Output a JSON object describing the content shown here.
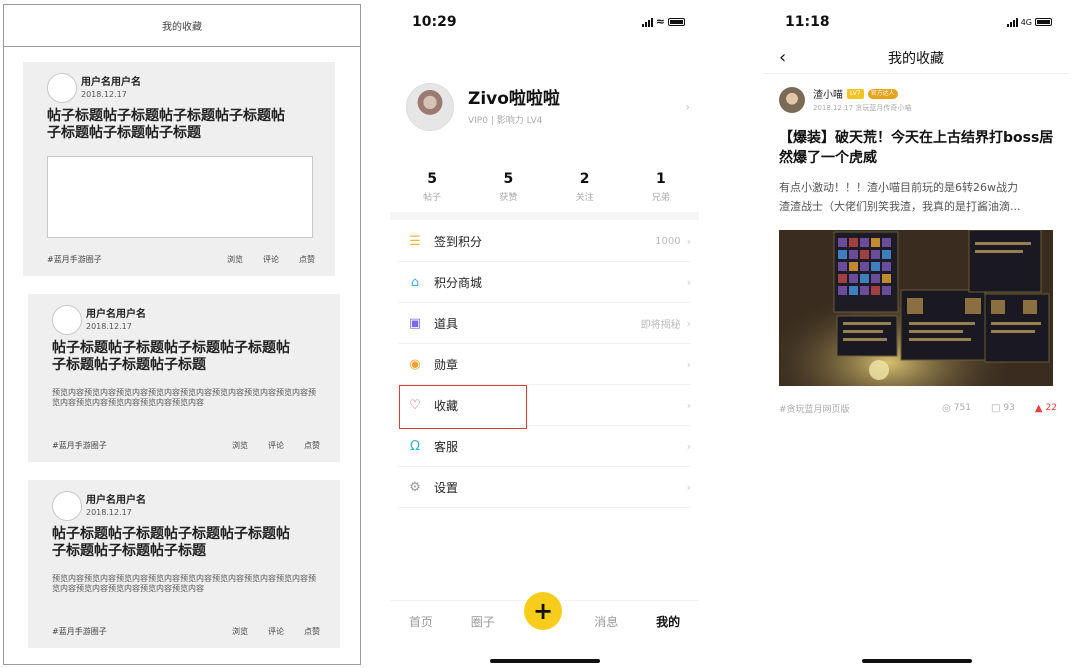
{
  "wireframe": {
    "header_title": "我的收藏",
    "cards": [
      {
        "username": "用户名用户名",
        "date": "2018.12.17",
        "title": "帖子标题帖子标题帖子标题帖子标题帖子标题帖子标题帖子标题",
        "preview": "",
        "tag": "#蓝月手游圈子",
        "action_view": "浏览",
        "action_comment": "评论",
        "action_like": "点赞"
      },
      {
        "username": "用户名用户名",
        "date": "2018.12.17",
        "title": "帖子标题帖子标题帖子标题帖子标题帖子标题帖子标题帖子标题",
        "preview": "预览内容预览内容预览内容预览内容预览内容预览内容预览内容预览内容预览内容预览内容预览内容预览内容预览内容",
        "tag": "#蓝月手游圈子",
        "action_view": "浏览",
        "action_comment": "评论",
        "action_like": "点赞"
      },
      {
        "username": "用户名用户名",
        "date": "2018.12.17",
        "title": "帖子标题帖子标题帖子标题帖子标题帖子标题帖子标题帖子标题",
        "preview": "预览内容预览内容预览内容预览内容预览内容预览内容预览内容预览内容预览内容预览内容预览内容预览内容预览内容",
        "tag": "#蓝月手游圈子",
        "action_view": "浏览",
        "action_comment": "评论",
        "action_like": "点赞"
      }
    ]
  },
  "profile": {
    "status_time": "10:29",
    "name": "Zivo啦啦啦",
    "vip": "VIP0",
    "influence": "影响力 LV4",
    "stats": [
      {
        "num": "5",
        "label": "帖子"
      },
      {
        "num": "5",
        "label": "获赞"
      },
      {
        "num": "2",
        "label": "关注"
      },
      {
        "num": "1",
        "label": "兄弟"
      }
    ],
    "menu": [
      {
        "icon": "coins-icon",
        "label": "签到积分",
        "right": "1000",
        "color": "#f4b73a"
      },
      {
        "icon": "store-icon",
        "label": "积分商城",
        "right": "",
        "color": "#48a7e8"
      },
      {
        "icon": "toolbox-icon",
        "label": "道具",
        "right": "即将揭秘",
        "color": "#7b6be8"
      },
      {
        "icon": "medal-icon",
        "label": "勋章",
        "right": "",
        "color": "#f2a12e"
      },
      {
        "icon": "heart-icon",
        "label": "收藏",
        "right": "",
        "color": "#e8475e"
      },
      {
        "icon": "headset-icon",
        "label": "客服",
        "right": "",
        "color": "#2fb6c9"
      },
      {
        "icon": "gear-icon",
        "label": "设置",
        "right": "",
        "color": "#999999"
      }
    ],
    "tabs": [
      "首页",
      "圈子",
      "消息",
      "我的"
    ],
    "fab": "+"
  },
  "favorites": {
    "status_time": "11:18",
    "network": "4G",
    "nav_title": "我的收藏",
    "post": {
      "username": "渣小喵",
      "badge1": "LV7",
      "badge2": "官方达人",
      "date": "2018.12.17",
      "source": "贪玩蓝月传奇小喵",
      "title": "【爆装】破天荒！今天在上古结界打boss居然爆了一个虎威",
      "desc_line1": "有点小激动！！！渣小喵目前玩的是6转26w战力",
      "desc_line2": "渣渣战士（大佬们别笑我渣，我真的是打酱油滴...",
      "tag": "#贪玩蓝月网页版",
      "views": "751",
      "comments": "93",
      "likes": "22"
    }
  }
}
